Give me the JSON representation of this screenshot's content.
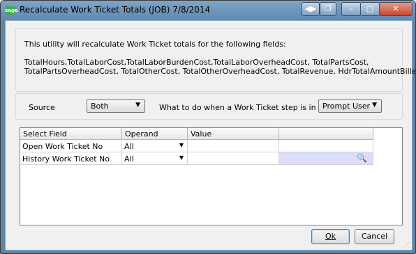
{
  "window": {
    "title": "Recalculate Work Ticket Totals (JOB) 7/8/2014",
    "app_icon": "sage",
    "buttons": {
      "nav": "◀▶",
      "restore": "❐",
      "minimize": "–",
      "maximize": "□",
      "close": "✕"
    }
  },
  "info": {
    "intro": "This utility will recalculate Work Ticket totals for the following fields:",
    "fields_line1": "TotalHours,TotalLaborCost,TotalLaborBurdenCost,TotalLaborOverheadCost, TotalPartsCost,",
    "fields_line2": "TotalPartsOverheadCost, TotalOtherCost, TotalOtherOverheadCost, TotalRevenue, HdrTotalAmountBilled."
  },
  "options": {
    "source_label": "Source",
    "source_value": "Both",
    "in_use_label": "What to do when a Work Ticket step is in use",
    "in_use_value": "Prompt User"
  },
  "grid": {
    "headers": [
      "Select Field",
      "Operand",
      "Value",
      ""
    ],
    "rows": [
      {
        "field": "Open Work Ticket No",
        "operand": "All",
        "value": ""
      },
      {
        "field": "History Work Ticket No",
        "operand": "All",
        "value": ""
      }
    ]
  },
  "footer": {
    "ok_label": "Ok",
    "cancel_label": "Cancel"
  },
  "colors": {
    "title_bar": "#6f97bf",
    "highlight_cell": "#dcdcfb"
  }
}
